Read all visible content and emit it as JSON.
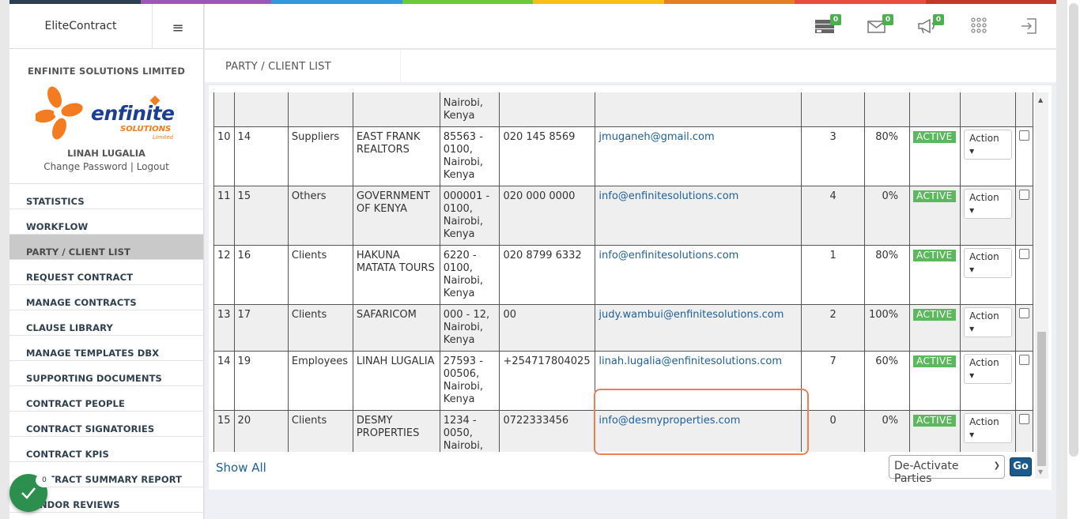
{
  "app": {
    "brand": "EliteContract",
    "colors": [
      "#2c3e50",
      "#9b59b6",
      "#3498db",
      "#6dc93c",
      "#f6be16",
      "#e67e22",
      "#e74c3c",
      "#c0392b"
    ]
  },
  "sidebar": {
    "company": "ENFINITE SOLUTIONS LIMITED",
    "logo": {
      "name": "enfinite",
      "tagline": "SOLUTIONS",
      "sub": "Limited"
    },
    "user": "LINAH LUGALIA",
    "change_password": "Change Password",
    "separator": "|",
    "logout": "Logout",
    "nav": [
      "STATISTICS",
      "WORKFLOW",
      "PARTY / CLIENT LIST",
      "REQUEST CONTRACT",
      "MANAGE CONTRACTS",
      "CLAUSE LIBRARY",
      "MANAGE TEMPLATES DBX",
      "SUPPORTING DOCUMENTS",
      "CONTRACT PEOPLE",
      "CONTRACT SIGNATORIES",
      "CONTRACT KPIS",
      "CONTRACT SUMMARY REPORT",
      "VENDOR REVIEWS"
    ],
    "active_index": 2,
    "fab_count": "0"
  },
  "topbar": {
    "icons": [
      {
        "name": "server-icon",
        "badge": "0"
      },
      {
        "name": "envelope-icon",
        "badge": "0"
      },
      {
        "name": "megaphone-icon",
        "badge": "0"
      },
      {
        "name": "apps-grid-icon",
        "badge": ""
      },
      {
        "name": "logout-icon",
        "badge": ""
      }
    ]
  },
  "page": {
    "title": "PARTY / CLIENT LIST"
  },
  "table": {
    "top_partial_address": "Nairobi, Kenya",
    "rows": [
      {
        "no": "10",
        "id": "14",
        "type": "Suppliers",
        "name": "EAST FRANK REALTORS",
        "address": "85563 - 0100, Nairobi, Kenya",
        "phone": "020 145 8569",
        "email": "jmuganeh@gmail.com",
        "count": "3",
        "pct": "80%",
        "status": "ACTIVE",
        "action": "Action"
      },
      {
        "no": "11",
        "id": "15",
        "type": "Others",
        "name": "GOVERNMENT OF KENYA",
        "address": "000001 - 0100, Nairobi, Kenya",
        "phone": "020 000 0000",
        "email": "info@enfinitesolutions.com",
        "count": "4",
        "pct": "0%",
        "status": "ACTIVE",
        "action": "Action"
      },
      {
        "no": "12",
        "id": "16",
        "type": "Clients",
        "name": "HAKUNA MATATA TOURS",
        "address": "6220 - 0100, Nairobi, Kenya",
        "phone": "020 8799 6332",
        "email": "info@enfinitesolutions.com",
        "count": "1",
        "pct": "80%",
        "status": "ACTIVE",
        "action": "Action"
      },
      {
        "no": "13",
        "id": "17",
        "type": "Clients",
        "name": "SAFARICOM",
        "address": "000 - 12, Nairobi, Kenya",
        "phone": "00",
        "email": "judy.wambui@enfinitesolutions.com",
        "count": "2",
        "pct": "100%",
        "status": "ACTIVE",
        "action": "Action"
      },
      {
        "no": "14",
        "id": "19",
        "type": "Employees",
        "name": "LINAH LUGALIA",
        "address": "27593 - 00506, Nairobi, Kenya",
        "phone": "+254717804025",
        "email": "linah.lugalia@enfinitesolutions.com",
        "count": "7",
        "pct": "60%",
        "status": "ACTIVE",
        "action": "Action"
      },
      {
        "no": "15",
        "id": "20",
        "type": "Clients",
        "name": "DESMY PROPERTIES",
        "address": "1234 - 0050, Nairobi, Kenya",
        "phone": "0722333456",
        "email": "info@desmyproperties.com",
        "count": "0",
        "pct": "0%",
        "status": "ACTIVE",
        "action": "Action"
      }
    ]
  },
  "footer": {
    "show_all": "Show All",
    "bulk_select": "De-Activate Parties",
    "go": "Go"
  }
}
